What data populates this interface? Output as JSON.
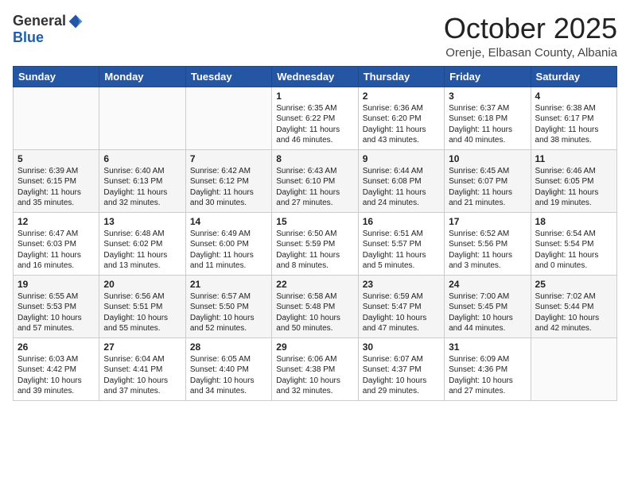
{
  "logo": {
    "general": "General",
    "blue": "Blue"
  },
  "header": {
    "month": "October 2025",
    "location": "Orenje, Elbasan County, Albania"
  },
  "weekdays": [
    "Sunday",
    "Monday",
    "Tuesday",
    "Wednesday",
    "Thursday",
    "Friday",
    "Saturday"
  ],
  "weeks": [
    [
      {
        "day": "",
        "info": ""
      },
      {
        "day": "",
        "info": ""
      },
      {
        "day": "",
        "info": ""
      },
      {
        "day": "1",
        "info": "Sunrise: 6:35 AM\nSunset: 6:22 PM\nDaylight: 11 hours\nand 46 minutes."
      },
      {
        "day": "2",
        "info": "Sunrise: 6:36 AM\nSunset: 6:20 PM\nDaylight: 11 hours\nand 43 minutes."
      },
      {
        "day": "3",
        "info": "Sunrise: 6:37 AM\nSunset: 6:18 PM\nDaylight: 11 hours\nand 40 minutes."
      },
      {
        "day": "4",
        "info": "Sunrise: 6:38 AM\nSunset: 6:17 PM\nDaylight: 11 hours\nand 38 minutes."
      }
    ],
    [
      {
        "day": "5",
        "info": "Sunrise: 6:39 AM\nSunset: 6:15 PM\nDaylight: 11 hours\nand 35 minutes."
      },
      {
        "day": "6",
        "info": "Sunrise: 6:40 AM\nSunset: 6:13 PM\nDaylight: 11 hours\nand 32 minutes."
      },
      {
        "day": "7",
        "info": "Sunrise: 6:42 AM\nSunset: 6:12 PM\nDaylight: 11 hours\nand 30 minutes."
      },
      {
        "day": "8",
        "info": "Sunrise: 6:43 AM\nSunset: 6:10 PM\nDaylight: 11 hours\nand 27 minutes."
      },
      {
        "day": "9",
        "info": "Sunrise: 6:44 AM\nSunset: 6:08 PM\nDaylight: 11 hours\nand 24 minutes."
      },
      {
        "day": "10",
        "info": "Sunrise: 6:45 AM\nSunset: 6:07 PM\nDaylight: 11 hours\nand 21 minutes."
      },
      {
        "day": "11",
        "info": "Sunrise: 6:46 AM\nSunset: 6:05 PM\nDaylight: 11 hours\nand 19 minutes."
      }
    ],
    [
      {
        "day": "12",
        "info": "Sunrise: 6:47 AM\nSunset: 6:03 PM\nDaylight: 11 hours\nand 16 minutes."
      },
      {
        "day": "13",
        "info": "Sunrise: 6:48 AM\nSunset: 6:02 PM\nDaylight: 11 hours\nand 13 minutes."
      },
      {
        "day": "14",
        "info": "Sunrise: 6:49 AM\nSunset: 6:00 PM\nDaylight: 11 hours\nand 11 minutes."
      },
      {
        "day": "15",
        "info": "Sunrise: 6:50 AM\nSunset: 5:59 PM\nDaylight: 11 hours\nand 8 minutes."
      },
      {
        "day": "16",
        "info": "Sunrise: 6:51 AM\nSunset: 5:57 PM\nDaylight: 11 hours\nand 5 minutes."
      },
      {
        "day": "17",
        "info": "Sunrise: 6:52 AM\nSunset: 5:56 PM\nDaylight: 11 hours\nand 3 minutes."
      },
      {
        "day": "18",
        "info": "Sunrise: 6:54 AM\nSunset: 5:54 PM\nDaylight: 11 hours\nand 0 minutes."
      }
    ],
    [
      {
        "day": "19",
        "info": "Sunrise: 6:55 AM\nSunset: 5:53 PM\nDaylight: 10 hours\nand 57 minutes."
      },
      {
        "day": "20",
        "info": "Sunrise: 6:56 AM\nSunset: 5:51 PM\nDaylight: 10 hours\nand 55 minutes."
      },
      {
        "day": "21",
        "info": "Sunrise: 6:57 AM\nSunset: 5:50 PM\nDaylight: 10 hours\nand 52 minutes."
      },
      {
        "day": "22",
        "info": "Sunrise: 6:58 AM\nSunset: 5:48 PM\nDaylight: 10 hours\nand 50 minutes."
      },
      {
        "day": "23",
        "info": "Sunrise: 6:59 AM\nSunset: 5:47 PM\nDaylight: 10 hours\nand 47 minutes."
      },
      {
        "day": "24",
        "info": "Sunrise: 7:00 AM\nSunset: 5:45 PM\nDaylight: 10 hours\nand 44 minutes."
      },
      {
        "day": "25",
        "info": "Sunrise: 7:02 AM\nSunset: 5:44 PM\nDaylight: 10 hours\nand 42 minutes."
      }
    ],
    [
      {
        "day": "26",
        "info": "Sunrise: 6:03 AM\nSunset: 4:42 PM\nDaylight: 10 hours\nand 39 minutes."
      },
      {
        "day": "27",
        "info": "Sunrise: 6:04 AM\nSunset: 4:41 PM\nDaylight: 10 hours\nand 37 minutes."
      },
      {
        "day": "28",
        "info": "Sunrise: 6:05 AM\nSunset: 4:40 PM\nDaylight: 10 hours\nand 34 minutes."
      },
      {
        "day": "29",
        "info": "Sunrise: 6:06 AM\nSunset: 4:38 PM\nDaylight: 10 hours\nand 32 minutes."
      },
      {
        "day": "30",
        "info": "Sunrise: 6:07 AM\nSunset: 4:37 PM\nDaylight: 10 hours\nand 29 minutes."
      },
      {
        "day": "31",
        "info": "Sunrise: 6:09 AM\nSunset: 4:36 PM\nDaylight: 10 hours\nand 27 minutes."
      },
      {
        "day": "",
        "info": ""
      }
    ]
  ]
}
